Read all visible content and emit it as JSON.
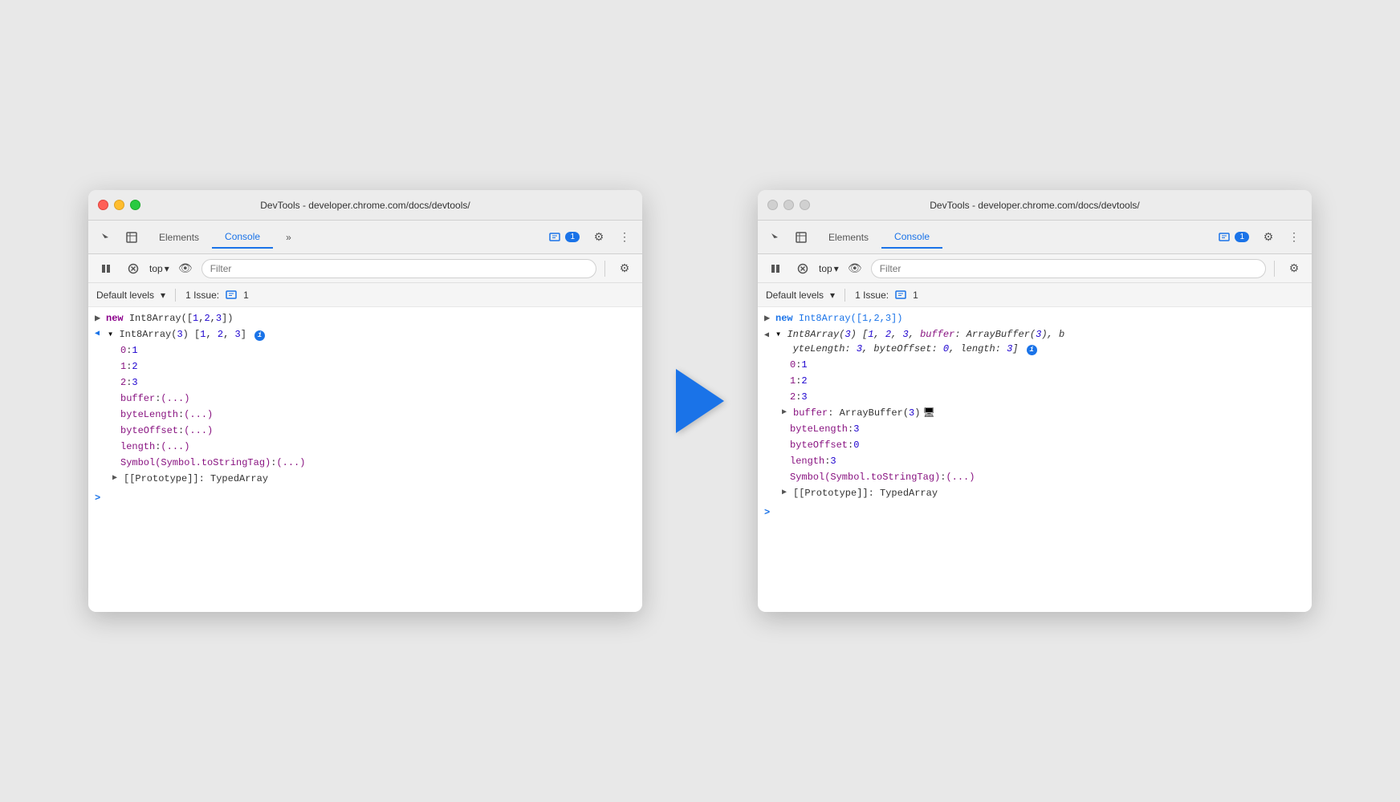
{
  "window1": {
    "title": "DevTools - developer.chrome.com/docs/devtools/",
    "tabs": [
      "Elements",
      "Console",
      "»"
    ],
    "active_tab": "Console",
    "badge_count": "1",
    "filter_placeholder": "Filter",
    "top_label": "top",
    "default_levels": "Default levels",
    "issues_label": "1 Issue:",
    "issues_count": "1",
    "console_lines": [
      {
        "type": "expandable",
        "indent": 0,
        "content": "new Int8Array([1,2,3])"
      },
      {
        "type": "expanded",
        "indent": 0,
        "content": "Int8Array(3) [1, 2, 3]"
      },
      {
        "type": "prop",
        "indent": 1,
        "key": "0",
        "value": "1"
      },
      {
        "type": "prop",
        "indent": 1,
        "key": "1",
        "value": "2"
      },
      {
        "type": "prop",
        "indent": 1,
        "key": "2",
        "value": "3"
      },
      {
        "type": "prop-lazy",
        "indent": 1,
        "key": "buffer",
        "value": "(...)"
      },
      {
        "type": "prop-lazy",
        "indent": 1,
        "key": "byteLength",
        "value": "(...)"
      },
      {
        "type": "prop-lazy",
        "indent": 1,
        "key": "byteOffset",
        "value": "(...)"
      },
      {
        "type": "prop-lazy",
        "indent": 1,
        "key": "length",
        "value": "(...)"
      },
      {
        "type": "prop-lazy",
        "indent": 1,
        "key": "Symbol(Symbol.toStringTag)",
        "value": "(...)"
      },
      {
        "type": "expandable",
        "indent": 1,
        "content": "[[Prototype]]: TypedArray"
      }
    ]
  },
  "window2": {
    "title": "DevTools - developer.chrome.com/docs/devtools/",
    "tabs": [
      "Elements",
      "Console"
    ],
    "active_tab": "Console",
    "badge_count": "1",
    "filter_placeholder": "Filter",
    "top_label": "top",
    "default_levels": "Default levels",
    "issues_label": "1 Issue:",
    "issues_count": "1",
    "console_lines": [
      {
        "type": "expandable",
        "indent": 0,
        "content": "new Int8Array([1,2,3])",
        "highlighted": true
      },
      {
        "type": "expanded-long",
        "indent": 0,
        "content": "Int8Array(3) [1, 2, 3, buffer: ArrayBuffer(3), byteLength: 3, byteOffset: 0, length: 3]",
        "highlighted": true
      },
      {
        "type": "prop",
        "indent": 1,
        "key": "0",
        "value": "1"
      },
      {
        "type": "prop",
        "indent": 1,
        "key": "1",
        "value": "2"
      },
      {
        "type": "prop",
        "indent": 1,
        "key": "2",
        "value": "3"
      },
      {
        "type": "prop-expandable",
        "indent": 1,
        "key": "buffer",
        "value": "ArrayBuffer(3)",
        "highlighted": true
      },
      {
        "type": "prop-resolved",
        "indent": 1,
        "key": "byteLength",
        "value": "3"
      },
      {
        "type": "prop-resolved",
        "indent": 1,
        "key": "byteOffset",
        "value": "0"
      },
      {
        "type": "prop-resolved",
        "indent": 1,
        "key": "length",
        "value": "3"
      },
      {
        "type": "prop-lazy",
        "indent": 1,
        "key": "Symbol(Symbol.toStringTag)",
        "value": "(...)"
      },
      {
        "type": "expandable",
        "indent": 1,
        "content": "[[Prototype]]: TypedArray"
      }
    ]
  },
  "arrow": "→"
}
